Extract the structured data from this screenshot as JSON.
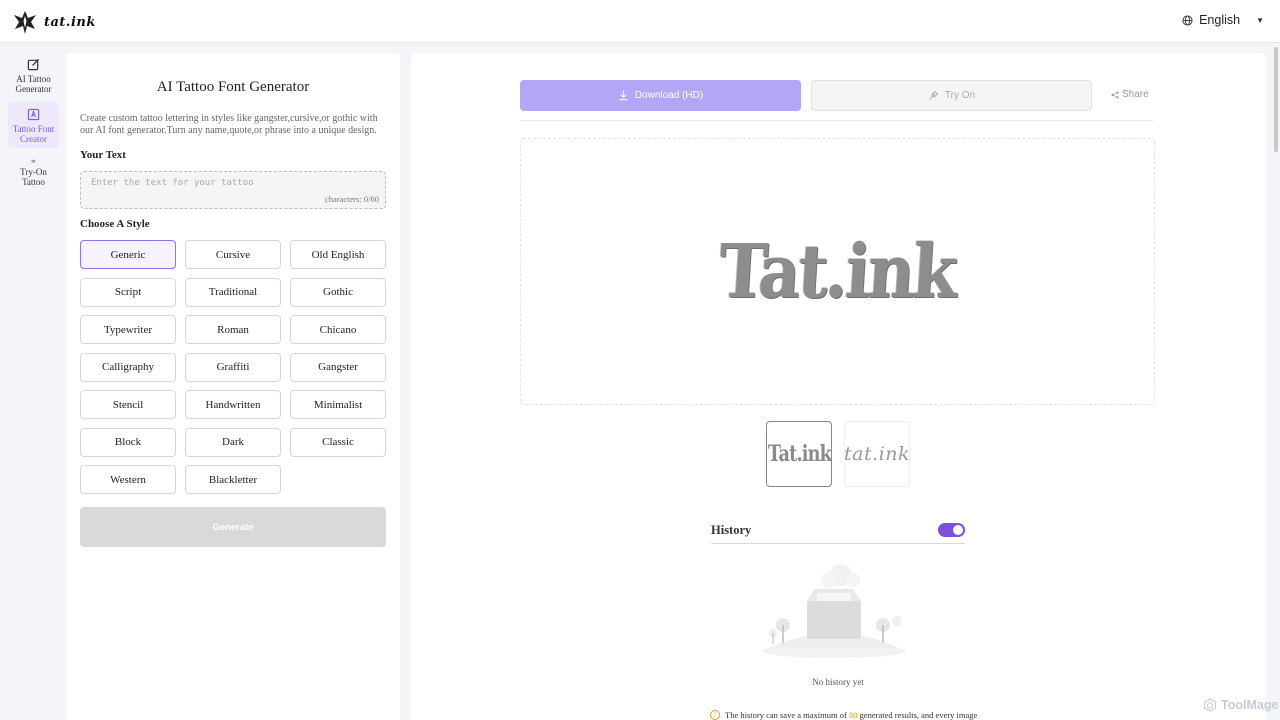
{
  "header": {
    "logo_text": "tat.ink",
    "language": "English"
  },
  "nav": {
    "items": [
      {
        "label": "AI Tattoo Generator"
      },
      {
        "label": "Tattoo Font Creator"
      },
      {
        "label": "Try-On Tattoo"
      }
    ]
  },
  "form": {
    "title": "AI Tattoo Font Generator",
    "description": "Create custom tattoo lettering in styles like gangster,cursive,or gothic with our AI font generator.Turn any name,quote,or phrase into a unique design.",
    "your_text_label": "Your Text",
    "text_placeholder": "Enter the text for your tattoo",
    "text_value": "",
    "char_counter": "characters: 0/60",
    "choose_style_label": "Choose A Style",
    "styles": [
      "Generic",
      "Cursive",
      "Old English",
      "Script",
      "Traditional",
      "Gothic",
      "Typewriter",
      "Roman",
      "Chicano",
      "Calligraphy",
      "Graffiti",
      "Gangster",
      "Stencil",
      "Handwritten",
      "Minimalist",
      "Block",
      "Dark",
      "Classic",
      "Western",
      "Blackletter"
    ],
    "selected_style": "Generic",
    "generate_label": "Generate"
  },
  "result": {
    "download_label": "Download (HD)",
    "tryon_label": "Try On",
    "share_label": "Share",
    "preview_text": "Tat.ink",
    "thumbnails": [
      "Tat.ink",
      "tat.ink"
    ],
    "history_title": "History",
    "history_enabled": true,
    "empty_text": "No history yet",
    "notice_prefix": "The history can save a maximum of",
    "notice_count": "80",
    "notice_suffix": "generated results, and every image"
  },
  "watermark": "ToolMage",
  "colors": {
    "accent": "#7b4fe0",
    "download_bg": "#b4a6f7",
    "selected_bg": "#f6f3ff"
  }
}
